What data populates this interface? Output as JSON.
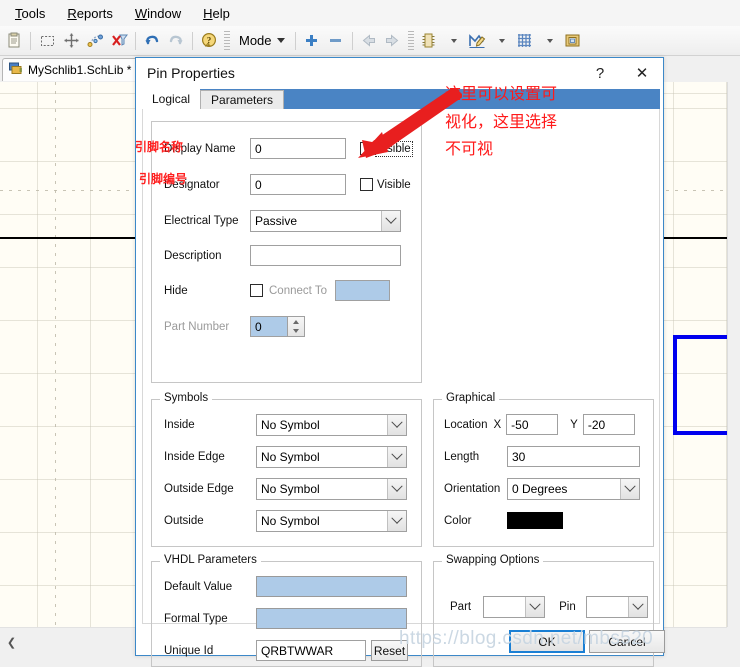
{
  "menubar": {
    "items": [
      {
        "label": "Tools",
        "accel": "T"
      },
      {
        "label": "Reports",
        "accel": "R"
      },
      {
        "label": "Window",
        "accel": "W"
      },
      {
        "label": "Help",
        "accel": "H"
      }
    ]
  },
  "toolbar": {
    "mode_label": "Mode",
    "icons": [
      "paste-icon",
      "select-area-icon",
      "move-icon",
      "jump-icon",
      "clear-filter-icon",
      "undo-icon",
      "redo-icon",
      "help-icon",
      "add-icon",
      "remove-icon",
      "prev-icon",
      "next-icon",
      "component-icon",
      "draw-tools-icon",
      "grid-icon",
      "library-icon"
    ]
  },
  "document_tab": {
    "label": "MySchlib1.SchLib *",
    "icon": "schematic-library-icon"
  },
  "dialog": {
    "title": "Pin Properties",
    "help_glyph": "?",
    "close_glyph": "✕",
    "tabs": [
      {
        "label": "Logical",
        "active": true
      },
      {
        "label": "Parameters",
        "active": false
      }
    ],
    "logical": {
      "display_name": {
        "label": "Display Name",
        "value": "0",
        "visible_label": "Visible",
        "visible_checked": false
      },
      "designator": {
        "label": "Designator",
        "value": "0",
        "visible_label": "Visible",
        "visible_checked": false
      },
      "electrical_type": {
        "label": "Electrical Type",
        "value": "Passive"
      },
      "description": {
        "label": "Description",
        "value": ""
      },
      "hide": {
        "label": "Hide",
        "checked": false,
        "connect_to_label": "Connect To",
        "connect_to_value": ""
      },
      "part_number": {
        "label": "Part Number",
        "value": "0"
      }
    },
    "symbols": {
      "legend": "Symbols",
      "rows": [
        {
          "label": "Inside",
          "value": "No Symbol"
        },
        {
          "label": "Inside Edge",
          "value": "No Symbol"
        },
        {
          "label": "Outside Edge",
          "value": "No Symbol"
        },
        {
          "label": "Outside",
          "value": "No Symbol"
        }
      ]
    },
    "graphical": {
      "legend": "Graphical",
      "location_label": "Location",
      "x_label": "X",
      "x_value": "-50",
      "y_label": "Y",
      "y_value": "-20",
      "length_label": "Length",
      "length_value": "30",
      "orientation_label": "Orientation",
      "orientation_value": "0 Degrees",
      "color_label": "Color",
      "color_value": "#000000"
    },
    "vhdl": {
      "legend": "VHDL Parameters",
      "default_value_label": "Default Value",
      "default_value": "",
      "formal_type_label": "Formal Type",
      "formal_type": "",
      "unique_id_label": "Unique Id",
      "unique_id": "QRBTWWAR",
      "reset_label": "Reset"
    },
    "swapping": {
      "legend": "Swapping Options",
      "part_label": "Part",
      "part_value": "",
      "pin_label": "Pin",
      "pin_value": ""
    },
    "footer": {
      "ok_label": "OK",
      "cancel_label": "Cancel"
    }
  },
  "annotations": {
    "pin_name_cn": "引脚名称",
    "pin_number_cn": "引脚编号",
    "arrow_note_line1": "这里可以设置可",
    "arrow_note_line2": "视化，这里选择",
    "arrow_note_line3": "不可视"
  },
  "watermark": {
    "text": "https://blog.csdn.net/mbs520"
  },
  "colors": {
    "dialog_border": "#3c88c8",
    "tabstrip": "#4a84c4",
    "annotation_red": "#ff1a1a",
    "pin_preview_fill": "#f9f5b5",
    "pin_preview_border": "#7a1111",
    "blue_field": "#aecbe8",
    "canvas_bg": "#fffdf5",
    "component_outline": "#0000ee"
  }
}
